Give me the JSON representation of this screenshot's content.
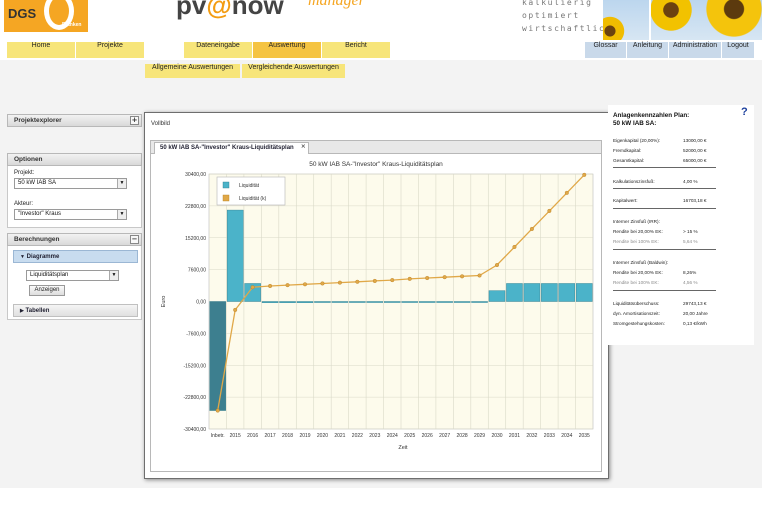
{
  "header": {
    "logo_text": "DGS",
    "logo_sub": "Franken",
    "brand_pv": "pv",
    "brand_at": "@",
    "brand_now": "now",
    "brand_manager": "manager",
    "tagline": [
      "kalkulierig",
      "optimiert",
      "wirtschaftlich"
    ]
  },
  "nav": {
    "items": [
      "Home",
      "Projekte",
      "Dateneingabe",
      "Auswertung",
      "Bericht"
    ],
    "right_items": [
      "Glossar",
      "Anleitung",
      "Administration",
      "Logout"
    ],
    "subnav": [
      "Allgemeine Auswertungen",
      "Vergleichende Auswertungen"
    ]
  },
  "left": {
    "projektexplorer": "Projektexplorer",
    "projektexplorer_btn": "+",
    "optionen": "Optionen",
    "projekt_label": "Projekt:",
    "projekt_value": "50 kW IAB SA",
    "akteur_label": "Akteur:",
    "akteur_value": "\"Investor\" Kraus",
    "berechnungen": "Berechnungen",
    "berechnungen_btn": "−",
    "diagramme": "Diagramme",
    "diagramm_select": "Liquiditätsplan",
    "anzeigen": "Anzeigen",
    "tabellen": "Tabellen"
  },
  "window": {
    "vollbild": "Vollbild",
    "tab_label": "50 kW IAB SA-\"Investor\" Kraus-Liquiditätsplan",
    "tab_close": "×"
  },
  "chart_data": {
    "type": "bar",
    "title": "50 kW IAB SA-\"Investor\" Kraus-Liquiditätsplan",
    "xlabel": "Zeit",
    "ylabel": "Euro",
    "categories": [
      "Inbetr.",
      "2015",
      "2016",
      "2017",
      "2018",
      "2019",
      "2020",
      "2021",
      "2022",
      "2023",
      "2024",
      "2025",
      "2026",
      "2027",
      "2028",
      "2029",
      "2030",
      "2031",
      "2032",
      "2033",
      "2034",
      "2035"
    ],
    "y_ticks": [
      "30400,00",
      "22800,00",
      "15200,00",
      "7600,00",
      "0,00",
      "-7600,00",
      "-15200,00",
      "-22800,00",
      "-30400,00"
    ],
    "ylim": [
      -30400,
      30400
    ],
    "grid": true,
    "legend_position": "top-left",
    "colors": {
      "bar": "#4bb3c9",
      "bar_negative": "#3d7f8f",
      "line": "#e0a848",
      "plot_bg": "#fdfbec"
    },
    "series": [
      {
        "name": "Liquidität",
        "kind": "bar",
        "values": [
          -26000,
          21800,
          4300,
          -300,
          -300,
          -300,
          -250,
          -250,
          -250,
          -250,
          -250,
          -250,
          -250,
          -250,
          -250,
          -250,
          2600,
          4300,
          4300,
          4300,
          4300,
          4300
        ]
      },
      {
        "name": "Liquidität (k)",
        "kind": "line",
        "values": [
          -26000,
          -2000,
          3400,
          3700,
          3900,
          4100,
          4300,
          4500,
          4700,
          4900,
          5100,
          5400,
          5600,
          5800,
          6000,
          6200,
          8700,
          13000,
          17300,
          21600,
          25900,
          30200
        ]
      }
    ]
  },
  "kennzahlen": {
    "title_line1": "Anlagenkennzahlen Plan:",
    "title_line2": "50 kW IAB SA:",
    "help": "?",
    "group1": [
      {
        "label": "Eigenkapital (20,00%):",
        "value": "13000,00 €"
      },
      {
        "label": "Fremdkapital:",
        "value": "52000,00 €"
      },
      {
        "label": "Gesamtkapital:",
        "value": "65000,00 €"
      }
    ],
    "kalkulationszinsfuss": {
      "label": "Kalkulationszinsfuß:",
      "value": "4,00 %"
    },
    "kapitalwert": {
      "label": "Kapitalwert:",
      "value": "16703,18 €"
    },
    "irr_title": "Interner Zinsfuß (IRR):",
    "irr": [
      {
        "label": "Rendite bei 20,00% EK:",
        "value": "> 15 %"
      },
      {
        "label": "Rendite bei 100% EK:",
        "value": "5,64 %",
        "grey": true
      }
    ],
    "baldwin_title": "Interner Zinsfuß (Baldwin):",
    "baldwin": [
      {
        "label": "Rendite bei 20,00% EK:",
        "value": "8,26%"
      },
      {
        "label": "Rendite bei 100% EK:",
        "value": "4,56 %",
        "grey": true
      }
    ],
    "bottom": [
      {
        "label": "Liquiditätsüberschuss:",
        "value": "29743,13 €"
      },
      {
        "label": "dyn. Amortisationszeit:",
        "value": "20,00 Jahre"
      },
      {
        "label": "Stromgestehungskosten:",
        "value": "0,13 €/kWh"
      }
    ]
  }
}
